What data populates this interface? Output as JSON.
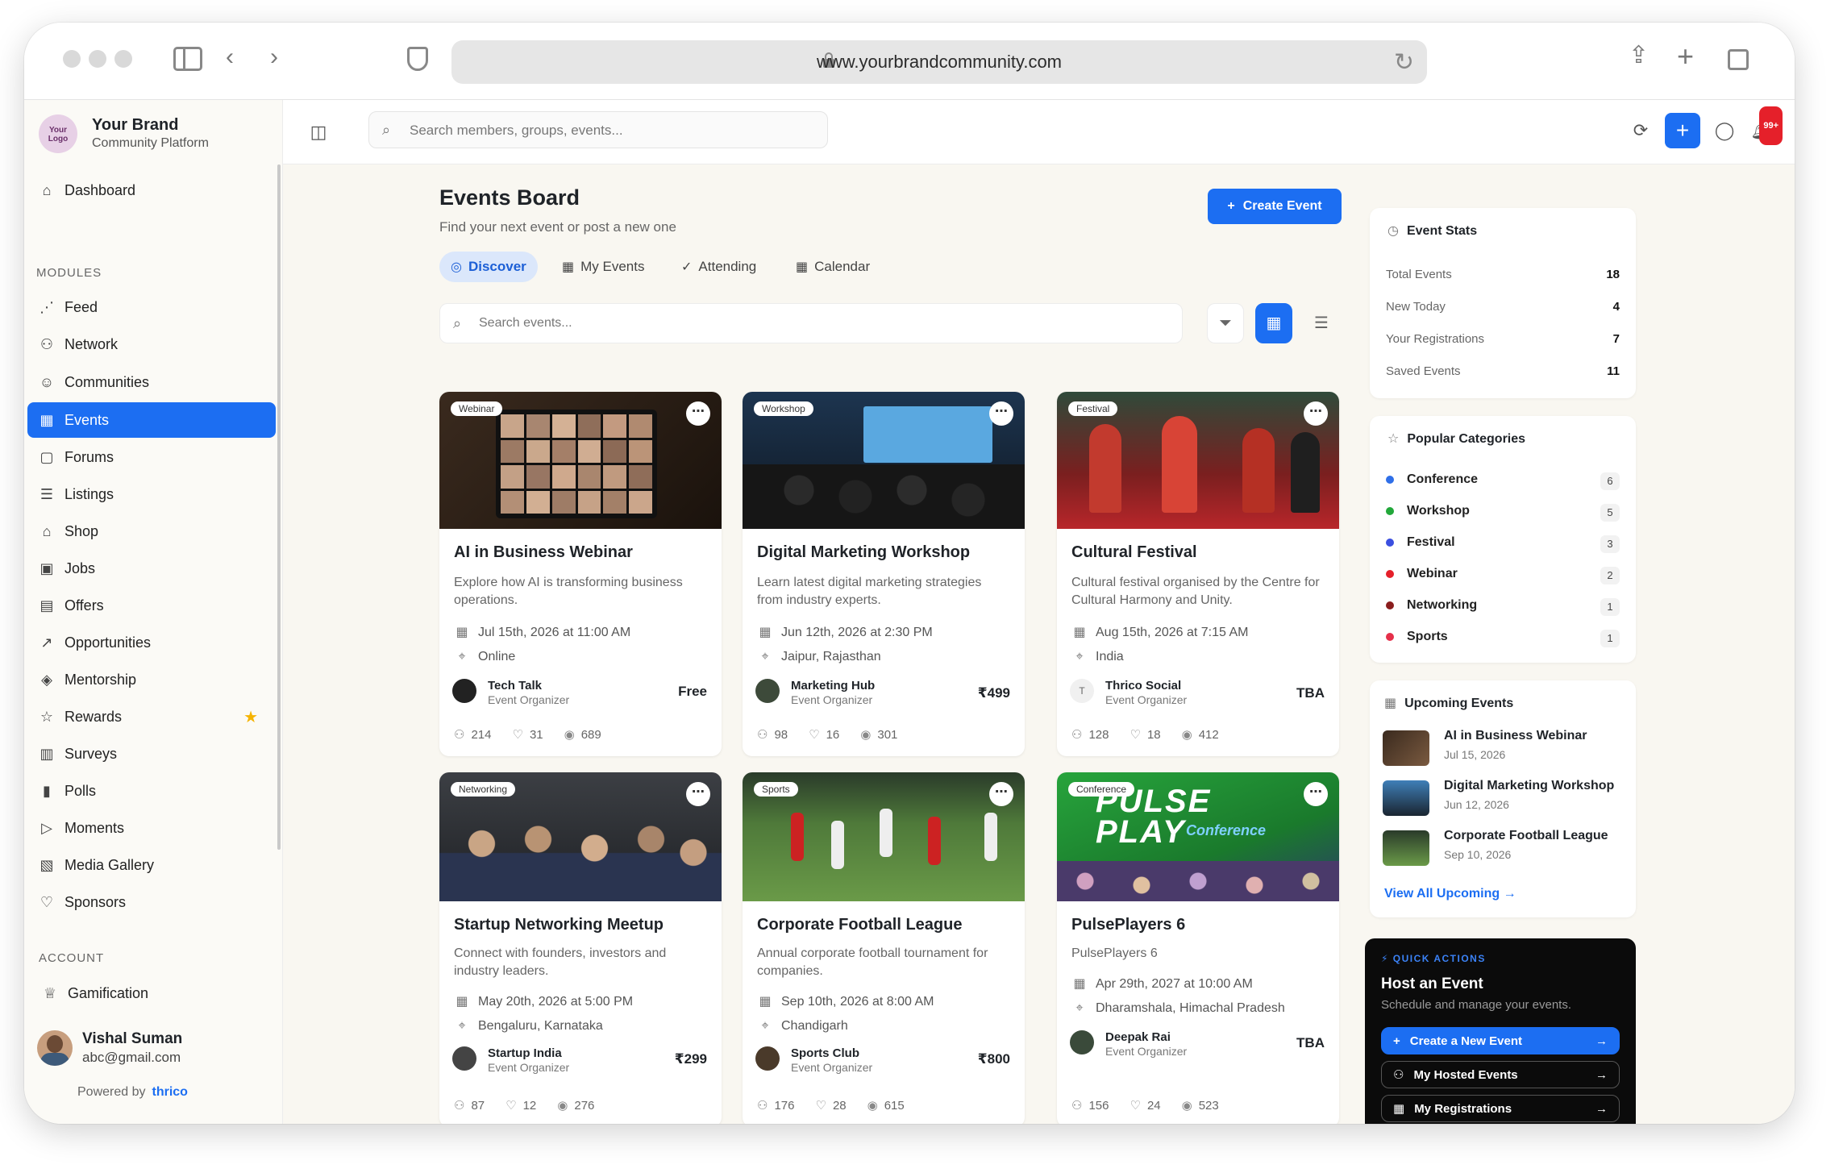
{
  "browser": {
    "url": "www.yourbrandcommunity.com"
  },
  "brand": {
    "logo_text": "Your Logo",
    "name": "Your Brand",
    "subtitle": "Community Platform"
  },
  "sidebar": {
    "dashboard": "Dashboard",
    "modules_label": "MODULES",
    "items": [
      {
        "label": "Feed",
        "icon": "rss-icon"
      },
      {
        "label": "Network",
        "icon": "network-icon"
      },
      {
        "label": "Communities",
        "icon": "users-icon"
      },
      {
        "label": "Events",
        "icon": "calendar-icon"
      },
      {
        "label": "Forums",
        "icon": "chat-icon"
      },
      {
        "label": "Listings",
        "icon": "list-icon"
      },
      {
        "label": "Shop",
        "icon": "store-icon"
      },
      {
        "label": "Jobs",
        "icon": "briefcase-icon"
      },
      {
        "label": "Offers",
        "icon": "gift-icon"
      },
      {
        "label": "Opportunities",
        "icon": "trend-icon"
      },
      {
        "label": "Mentorship",
        "icon": "cap-icon"
      },
      {
        "label": "Rewards",
        "icon": "star-icon"
      },
      {
        "label": "Surveys",
        "icon": "clipboard-icon"
      },
      {
        "label": "Polls",
        "icon": "bar-icon"
      },
      {
        "label": "Moments",
        "icon": "play-icon"
      },
      {
        "label": "Media Gallery",
        "icon": "image-icon"
      },
      {
        "label": "Sponsors",
        "icon": "handshake-icon"
      }
    ],
    "account_label": "ACCOUNT",
    "gamification": "Gamification",
    "user": {
      "name": "Vishal Suman",
      "email": "abc@gmail.com"
    },
    "powered_by": "Powered by",
    "powered_brand": "thrico"
  },
  "topbar": {
    "search_placeholder": "Search members, groups, events...",
    "notification_badge": "99+"
  },
  "page": {
    "title": "Events Board",
    "subtitle": "Find your next event or post a new one",
    "create_button": "Create Event",
    "tabs": [
      "Discover",
      "My Events",
      "Attending",
      "Calendar"
    ],
    "search_placeholder": "Search events..."
  },
  "events": [
    {
      "tag": "Webinar",
      "title": "AI in Business Webinar",
      "desc": "Explore how AI is transforming business operations.",
      "date": "Jul 15th, 2026 at 11:00 AM",
      "location": "Online",
      "organizer": "Tech Talk",
      "role": "Event Organizer",
      "price": "Free",
      "attendees": "214",
      "likes": "31",
      "views": "689"
    },
    {
      "tag": "Workshop",
      "title": "Digital Marketing Workshop",
      "desc": "Learn latest digital marketing strategies from industry experts.",
      "date": "Jun 12th, 2026 at 2:30 PM",
      "location": "Jaipur, Rajasthan",
      "organizer": "Marketing Hub",
      "role": "Event Organizer",
      "price": "₹499",
      "attendees": "98",
      "likes": "16",
      "views": "301"
    },
    {
      "tag": "Festival",
      "title": "Cultural Festival",
      "desc": "Cultural festival organised by the Centre for Cultural Harmony and Unity.",
      "date": "Aug 15th, 2026 at 7:15 AM",
      "location": "India",
      "organizer": "Thrico Social",
      "role": "Event Organizer",
      "price": "TBA",
      "attendees": "128",
      "likes": "18",
      "views": "412",
      "avatar_letter": "T"
    },
    {
      "tag": "Networking",
      "title": "Startup Networking Meetup",
      "desc": "Connect with founders, investors and industry leaders.",
      "date": "May 20th, 2026 at 5:00 PM",
      "location": "Bengaluru, Karnataka",
      "organizer": "Startup India",
      "role": "Event Organizer",
      "price": "₹299",
      "attendees": "87",
      "likes": "12",
      "views": "276"
    },
    {
      "tag": "Sports",
      "title": "Corporate Football League",
      "desc": "Annual corporate football tournament for companies.",
      "date": "Sep 10th, 2026 at 8:00 AM",
      "location": "Chandigarh",
      "organizer": "Sports Club",
      "role": "Event Organizer",
      "price": "₹800",
      "attendees": "176",
      "likes": "28",
      "views": "615"
    },
    {
      "tag": "Conference",
      "title": "PulsePlayers 6",
      "desc": "PulsePlayers 6",
      "date": "Apr 29th, 2027 at 10:00 AM",
      "location": "Dharamshala, Himachal Pradesh",
      "organizer": "Deepak Rai",
      "role": "Event Organizer",
      "price": "TBA",
      "attendees": "156",
      "likes": "24",
      "views": "523",
      "banner_line1": "PULSE",
      "banner_line2": "PLAY",
      "banner_line3": "Conference"
    }
  ],
  "stats": {
    "title": "Event Stats",
    "rows": [
      {
        "label": "Total Events",
        "value": "18"
      },
      {
        "label": "New Today",
        "value": "4"
      },
      {
        "label": "Your Registrations",
        "value": "7"
      },
      {
        "label": "Saved Events",
        "value": "11"
      }
    ]
  },
  "categories": {
    "title": "Popular Categories",
    "items": [
      {
        "label": "Conference",
        "count": "6",
        "color": "#2f6fe8"
      },
      {
        "label": "Workshop",
        "count": "5",
        "color": "#22a83a"
      },
      {
        "label": "Festival",
        "count": "3",
        "color": "#3b4fe0"
      },
      {
        "label": "Webinar",
        "count": "2",
        "color": "#e5202a"
      },
      {
        "label": "Networking",
        "count": "1",
        "color": "#8a1d1d"
      },
      {
        "label": "Sports",
        "count": "1",
        "color": "#e5304a"
      }
    ]
  },
  "upcoming": {
    "title": "Upcoming Events",
    "items": [
      {
        "title": "AI in Business Webinar",
        "date": "Jul 15, 2026"
      },
      {
        "title": "Digital Marketing Workshop",
        "date": "Jun 12, 2026"
      },
      {
        "title": "Corporate Football League",
        "date": "Sep 10, 2026"
      }
    ],
    "view_all": "View All Upcoming"
  },
  "quick_actions": {
    "label": "QUICK ACTIONS",
    "title": "Host an Event",
    "subtitle": "Schedule and manage your events.",
    "buttons": [
      "Create a New Event",
      "My Hosted Events",
      "My Registrations"
    ]
  }
}
